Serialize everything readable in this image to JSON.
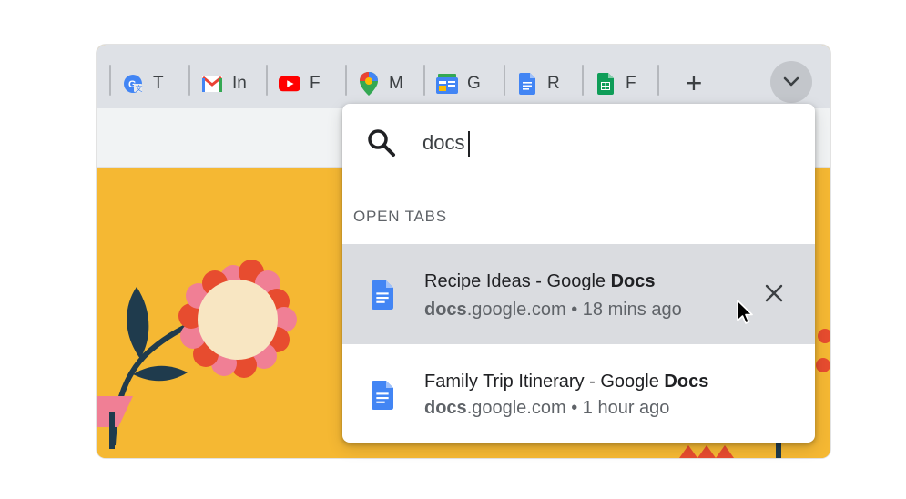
{
  "tabs": [
    {
      "icon": "google-translate-icon",
      "title": "T"
    },
    {
      "icon": "gmail-icon",
      "title": "In"
    },
    {
      "icon": "youtube-icon",
      "title": "F"
    },
    {
      "icon": "google-maps-icon",
      "title": "M"
    },
    {
      "icon": "google-news-icon",
      "title": "G"
    },
    {
      "icon": "google-docs-icon",
      "title": "R"
    },
    {
      "icon": "google-sheets-icon",
      "title": "F"
    }
  ],
  "new_tab_label": "+",
  "search": {
    "value": "docs",
    "section_label": "OPEN TABS"
  },
  "results": [
    {
      "icon": "google-docs-icon",
      "title_prefix": "Recipe Ideas - Google ",
      "title_match": "Docs",
      "domain_match": "docs",
      "domain_rest": ".google.com",
      "time": " • 18 mins ago"
    },
    {
      "icon": "google-docs-icon",
      "title_prefix": "Family Trip Itinerary - Google ",
      "title_match": "Docs",
      "domain_match": "docs",
      "domain_rest": ".google.com",
      "time": " • 1 hour ago"
    }
  ],
  "colors": {
    "tabstrip": "#dee1e6",
    "page_background": "#f5b833",
    "docs_blue": "#4285f4",
    "active_row": "#dadce0"
  }
}
